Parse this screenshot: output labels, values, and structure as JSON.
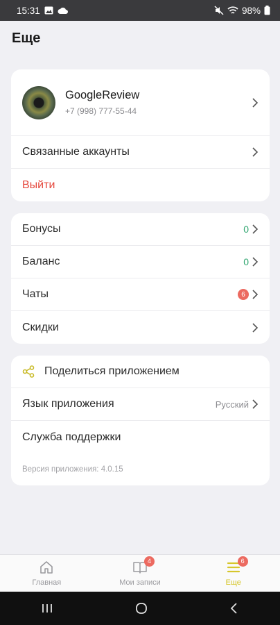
{
  "status_bar": {
    "time": "15:31",
    "battery": "98%"
  },
  "page_title": "Еще",
  "profile": {
    "name": "GoogleReview",
    "phone": "+7 (998) 777-55-44"
  },
  "account_card": {
    "linked_accounts": "Связанные аккаунты",
    "logout": "Выйти"
  },
  "finance_card": {
    "bonuses": {
      "label": "Бонусы",
      "value": "0"
    },
    "balance": {
      "label": "Баланс",
      "value": "0"
    },
    "chats": {
      "label": "Чаты",
      "badge": "6"
    },
    "discounts": {
      "label": "Скидки"
    }
  },
  "settings_card": {
    "share": "Поделиться приложением",
    "language_label": "Язык приложения",
    "language_value": "Русский",
    "support": "Служба поддержки",
    "version": "Версия приложения: 4.0.15"
  },
  "tab_bar": {
    "home": "Главная",
    "records": "Мои записи",
    "records_badge": "4",
    "more": "Еще",
    "more_badge": "6"
  },
  "colors": {
    "accent_yellow": "#d6c62b",
    "danger_red": "#e5483d",
    "success_green": "#2fa56f",
    "badge_red": "#ec6a60"
  },
  "icons": {
    "status_left": [
      "image-icon",
      "cloud-icon"
    ],
    "status_right": [
      "mute-icon",
      "wifi-icon",
      "battery-icon"
    ],
    "share": "share-icon",
    "tabs": [
      "home-icon",
      "book-icon",
      "menu-icon"
    ],
    "system_nav": [
      "recents-icon",
      "home-circle-icon",
      "back-icon"
    ]
  }
}
